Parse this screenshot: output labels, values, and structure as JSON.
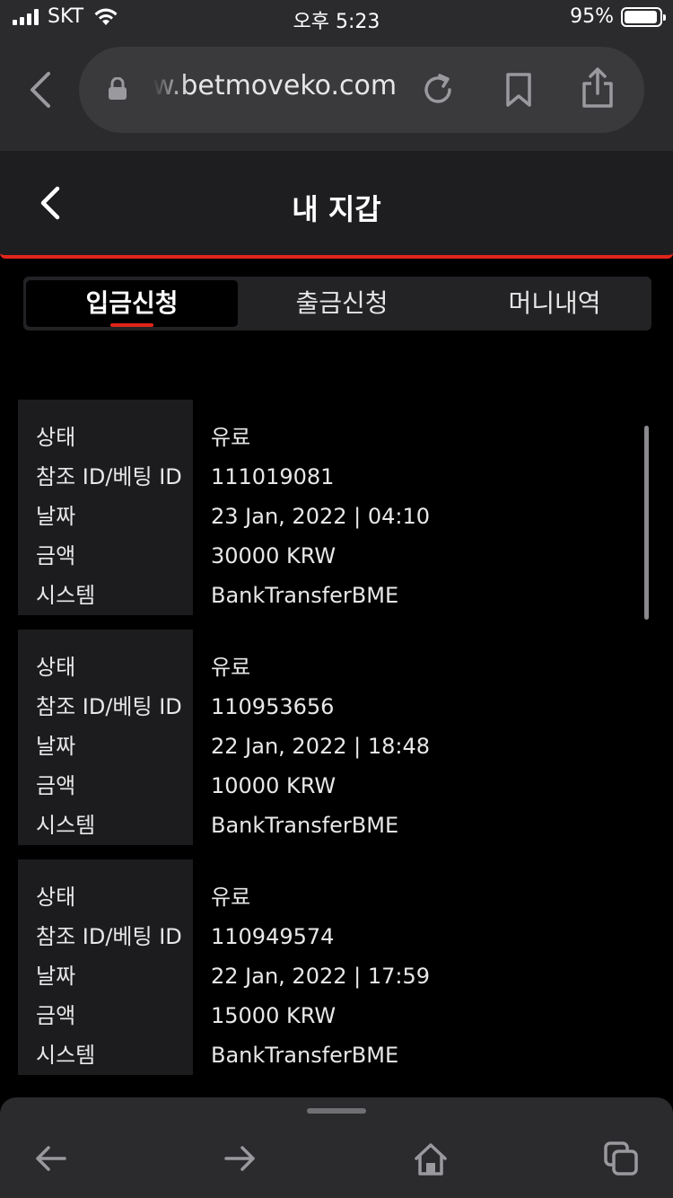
{
  "status_bar": {
    "carrier": "SKT",
    "time": "오후 5:23",
    "battery": "95%",
    "battery_level": 0.95
  },
  "browser": {
    "url": "w.betmoveko.com"
  },
  "header": {
    "title": "내 지갑"
  },
  "tabs": [
    {
      "label": "입금신청",
      "active": true
    },
    {
      "label": "출금신청",
      "active": false
    },
    {
      "label": "머니내역",
      "active": false
    }
  ],
  "records": [
    {
      "labels": [
        "상태",
        "참조 ID/베팅 ID",
        "날짜",
        "금액",
        "시스템"
      ],
      "status": "유료",
      "ref_id": "111019081",
      "date": "23 Jan, 2022 | 04:10",
      "amount": "30000 KRW",
      "system": "BankTransferBME"
    },
    {
      "labels": [
        "상태",
        "참조 ID/베팅 ID",
        "날짜",
        "금액",
        "시스템"
      ],
      "status": "유료",
      "ref_id": "110953656",
      "date": "22 Jan, 2022 | 18:48",
      "amount": "10000 KRW",
      "system": "BankTransferBME"
    },
    {
      "labels": [
        "상태",
        "참조 ID/베팅 ID",
        "날짜",
        "금액",
        "시스템"
      ],
      "status": "유료",
      "ref_id": "110949574",
      "date": "22 Jan, 2022 | 17:59",
      "amount": "15000 KRW",
      "system": "BankTransferBME"
    }
  ],
  "colors": {
    "accent": "#e0251b",
    "background": "#000000",
    "panel": "#1c1c1f"
  }
}
